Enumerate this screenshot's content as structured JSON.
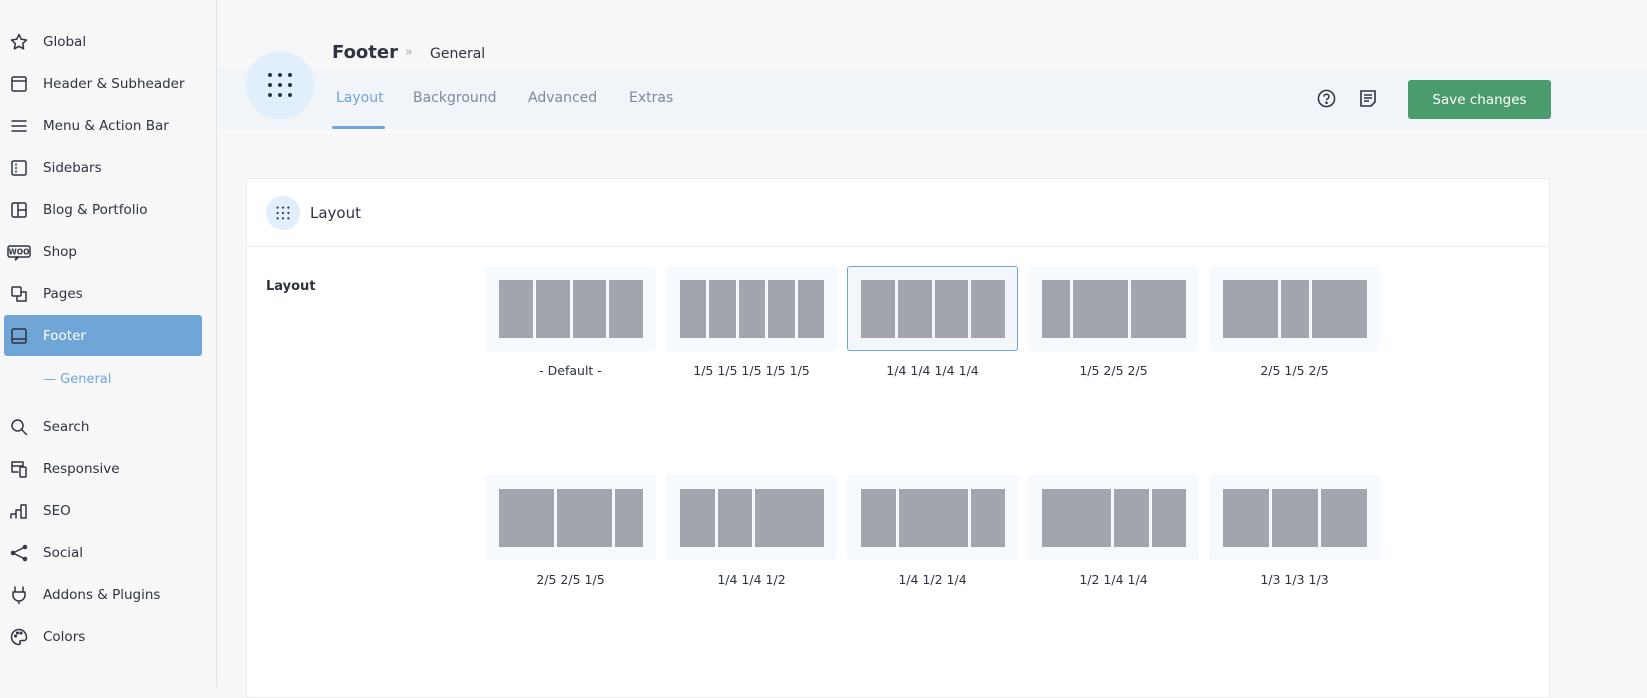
{
  "sidebar": {
    "items": [
      {
        "label": "Global",
        "icon": "star-icon"
      },
      {
        "label": "Header & Subheader",
        "icon": "header-icon"
      },
      {
        "label": "Menu & Action Bar",
        "icon": "menu-icon"
      },
      {
        "label": "Sidebars",
        "icon": "sidebar-icon"
      },
      {
        "label": "Blog & Portfolio",
        "icon": "blog-icon"
      },
      {
        "label": "Shop",
        "icon": "woo-icon"
      },
      {
        "label": "Pages",
        "icon": "pages-icon"
      },
      {
        "label": "Footer",
        "icon": "footer-icon",
        "active": true
      },
      {
        "label": "Search",
        "icon": "search-icon"
      },
      {
        "label": "Responsive",
        "icon": "responsive-icon"
      },
      {
        "label": "SEO",
        "icon": "seo-icon"
      },
      {
        "label": "Social",
        "icon": "share-icon"
      },
      {
        "label": "Addons & Plugins",
        "icon": "plug-icon"
      },
      {
        "label": "Colors",
        "icon": "palette-icon"
      }
    ],
    "sub_item": "— General",
    "woo_text": "WOO"
  },
  "header": {
    "title": "Footer",
    "separator": "»",
    "breadcrumb": "General",
    "tabs": [
      {
        "label": "Layout",
        "active": true
      },
      {
        "label": "Background"
      },
      {
        "label": "Advanced"
      },
      {
        "label": "Extras"
      }
    ],
    "save_label": "Save changes",
    "accent": "#70a5d8",
    "save_color": "#4a9c6c"
  },
  "card": {
    "title": "Layout",
    "field_label": "Layout",
    "options": [
      {
        "label": "- Default -",
        "cols": [
          1,
          1,
          1,
          1
        ]
      },
      {
        "label": "1/5 1/5 1/5 1/5 1/5",
        "cols": [
          1,
          1,
          1,
          1,
          1
        ]
      },
      {
        "label": "1/4 1/4 1/4 1/4",
        "cols": [
          1,
          1,
          1,
          1
        ],
        "selected": true
      },
      {
        "label": "1/5 2/5 2/5",
        "cols": [
          1,
          2,
          2
        ]
      },
      {
        "label": "2/5 1/5 2/5",
        "cols": [
          2,
          1,
          2
        ]
      },
      {
        "label": "2/5 2/5 1/5",
        "cols": [
          2,
          2,
          1
        ]
      },
      {
        "label": "1/4 1/4 1/2",
        "cols": [
          1,
          1,
          2
        ]
      },
      {
        "label": "1/4 1/2 1/4",
        "cols": [
          1,
          2,
          1
        ]
      },
      {
        "label": "1/2 1/4 1/4",
        "cols": [
          2,
          1,
          1
        ]
      },
      {
        "label": "1/3 1/3 1/3",
        "cols": [
          1,
          1,
          1
        ]
      }
    ]
  }
}
